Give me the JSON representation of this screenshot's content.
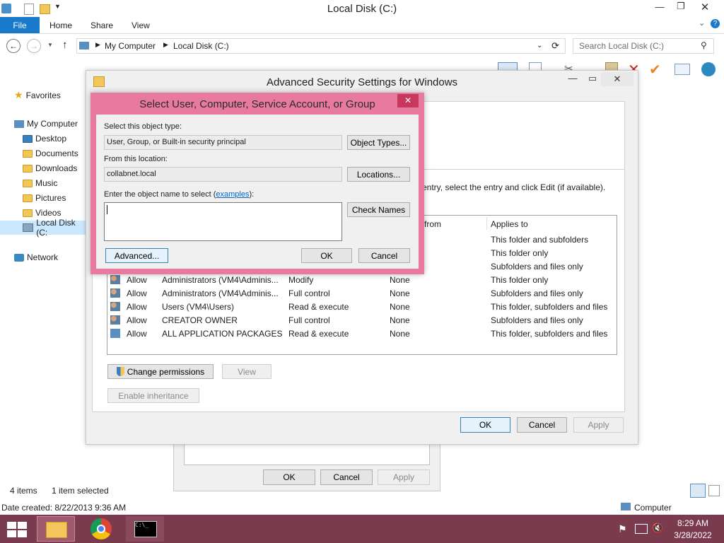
{
  "explorer": {
    "title": "Local Disk (C:)",
    "ribbon_tabs": [
      "File",
      "Home",
      "Share",
      "View"
    ],
    "address": {
      "root": "My Computer",
      "current": "Local Disk (C:)"
    },
    "search_placeholder": "Search Local Disk (C:)",
    "nav": {
      "favorites": "Favorites",
      "my_computer": "My Computer",
      "items": [
        "Desktop",
        "Documents",
        "Downloads",
        "Music",
        "Pictures",
        "Videos",
        "Local Disk (C:"
      ],
      "network": "Network"
    },
    "status": {
      "items": "4 items",
      "selected": "1 item selected"
    },
    "details": {
      "date_created": "Date created: 8/22/2013 9:36 AM",
      "location": "Computer"
    }
  },
  "properties_dialog": {
    "ok": "OK",
    "cancel": "Cancel",
    "apply": "Apply"
  },
  "advanced_security": {
    "title": "Advanced Security Settings for Windows",
    "hint_text": "entry, select the entry and click Edit (if available).",
    "columns": {
      "inherited_from": "from",
      "applies_to": "Applies to"
    },
    "applies_top": [
      "This folder and subfolders",
      "This folder only",
      "Subfolders and files only"
    ],
    "entries": [
      {
        "type": "Allow",
        "principal": "Administrators (VM4\\Adminis...",
        "access": "Modify",
        "inherited": "None",
        "applies": "This folder only"
      },
      {
        "type": "Allow",
        "principal": "Administrators (VM4\\Adminis...",
        "access": "Full control",
        "inherited": "None",
        "applies": "Subfolders and files only"
      },
      {
        "type": "Allow",
        "principal": "Users (VM4\\Users)",
        "access": "Read & execute",
        "inherited": "None",
        "applies": "This folder, subfolders and files"
      },
      {
        "type": "Allow",
        "principal": "CREATOR OWNER",
        "access": "Full control",
        "inherited": "None",
        "applies": "Subfolders and files only"
      },
      {
        "type": "Allow",
        "principal": "ALL APPLICATION PACKAGES",
        "access": "Read & execute",
        "inherited": "None",
        "applies": "This folder, subfolders and files"
      }
    ],
    "buttons": {
      "change_permissions": "Change permissions",
      "view": "View",
      "enable_inheritance": "Enable inheritance",
      "ok": "OK",
      "cancel": "Cancel",
      "apply": "Apply"
    }
  },
  "select_dialog": {
    "title": "Select User, Computer, Service Account, or Group",
    "object_type_label": "Select this object type:",
    "object_type_value": "User, Group, or Built-in security principal",
    "object_types_button": "Object Types...",
    "location_label": "From this location:",
    "location_value": "collabnet.local",
    "locations_button": "Locations...",
    "name_label_prefix": "Enter the object name to select (",
    "name_label_link": "examples",
    "name_label_suffix": "):",
    "name_value": "",
    "check_names_button": "Check Names",
    "advanced_button": "Advanced...",
    "ok": "OK",
    "cancel": "Cancel",
    "close_glyph": "✕"
  },
  "taskbar": {
    "time": "8:29 AM",
    "date": "3/28/2022"
  },
  "colors": {
    "accent": "#1979ca",
    "dialog_border": "#e05c8a",
    "link": "#0066cc"
  }
}
